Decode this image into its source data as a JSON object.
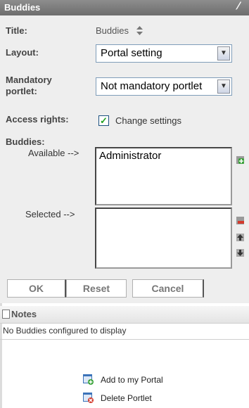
{
  "portlet": {
    "title": "Buddies",
    "edit_icon": "pencil-icon"
  },
  "form": {
    "title_label": "Title:",
    "title_value": "Buddies",
    "layout_label": "Layout:",
    "layout_value": "Portal setting",
    "mandatory_label_line1": "Mandatory",
    "mandatory_label_line2": "portlet:",
    "mandatory_value": "Not mandatory portlet",
    "access_label": "Access rights:",
    "access_checked": true,
    "access_option": "Change settings",
    "buddies_label": "Buddies:",
    "available_label": "Available -->",
    "available_items": [
      "Administrator"
    ],
    "selected_label": "Selected -->",
    "selected_items": []
  },
  "buttons": {
    "ok": "OK",
    "reset": "Reset",
    "cancel": "Cancel"
  },
  "notes": {
    "title": "Notes",
    "message": "No Buddies configured to display"
  },
  "actions": {
    "add": "Add to my Portal",
    "delete": "Delete Portlet"
  },
  "colors": {
    "titlebar": "#7a7a7a",
    "panel": "#eeeeee",
    "add_green": "#3aa33a",
    "delete_red": "#d33a2c",
    "icon_blue": "#3b73b9"
  }
}
